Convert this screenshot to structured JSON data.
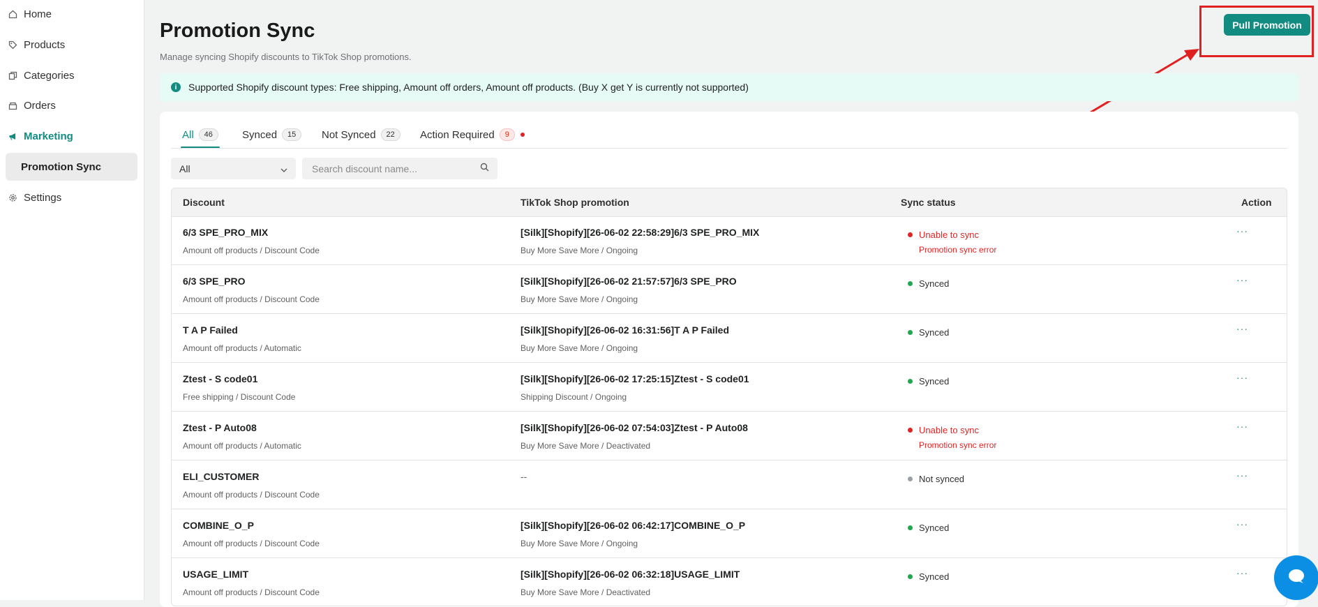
{
  "sidebar": {
    "items": [
      {
        "label": "Home",
        "icon": "home-icon"
      },
      {
        "label": "Products",
        "icon": "tag-icon"
      },
      {
        "label": "Categories",
        "icon": "categories-icon"
      },
      {
        "label": "Orders",
        "icon": "orders-icon"
      },
      {
        "label": "Marketing",
        "icon": "megaphone-icon"
      },
      {
        "label": "Promotion Sync"
      },
      {
        "label": "Settings",
        "icon": "gear-icon"
      }
    ]
  },
  "header": {
    "title": "Promotion Sync",
    "subtitle": "Manage syncing Shopify discounts to TikTok Shop promotions.",
    "pull_button": "Pull Promotion"
  },
  "banner": {
    "text": "Supported Shopify discount types: Free shipping, Amount off orders, Amount off products. (Buy X get Y is currently not supported)"
  },
  "tabs": [
    {
      "label": "All",
      "count": "46"
    },
    {
      "label": "Synced",
      "count": "15"
    },
    {
      "label": "Not Synced",
      "count": "22"
    },
    {
      "label": "Action Required",
      "count": "9"
    }
  ],
  "filter": {
    "selected": "All"
  },
  "search": {
    "placeholder": "Search discount name..."
  },
  "table": {
    "headers": [
      "Discount",
      "TikTok Shop promotion",
      "Sync status",
      "Action"
    ],
    "action_label": "···",
    "rows": [
      {
        "name": "6/3 SPE_PRO_MIX",
        "type": "Amount off products / Discount Code",
        "promo": "[Silk][Shopify][26-06-02 22:58:29]6/3 SPE_PRO_MIX",
        "promo_sub": "Buy More Save More / Ongoing",
        "status": "Unable to sync",
        "status_detail": "Promotion sync error"
      },
      {
        "name": "6/3 SPE_PRO",
        "type": "Amount off products / Discount Code",
        "promo": "[Silk][Shopify][26-06-02 21:57:57]6/3 SPE_PRO",
        "promo_sub": "Buy More Save More / Ongoing",
        "status": "Synced",
        "status_detail": ""
      },
      {
        "name": "T A P Failed",
        "type": "Amount off products / Automatic",
        "promo": "[Silk][Shopify][26-06-02 16:31:56]T A P Failed",
        "promo_sub": "Buy More Save More / Ongoing",
        "status": "Synced",
        "status_detail": ""
      },
      {
        "name": "Ztest - S code01",
        "type": "Free shipping / Discount Code",
        "promo": "[Silk][Shopify][26-06-02 17:25:15]Ztest - S code01",
        "promo_sub": "Shipping Discount / Ongoing",
        "status": "Synced",
        "status_detail": ""
      },
      {
        "name": "Ztest - P Auto08",
        "type": "Amount off products / Automatic",
        "promo": "[Silk][Shopify][26-06-02 07:54:03]Ztest - P Auto08",
        "promo_sub": "Buy More Save More / Deactivated",
        "status": "Unable to sync",
        "status_detail": "Promotion sync error"
      },
      {
        "name": "ELI_CUSTOMER",
        "type": "Amount off products / Discount Code",
        "promo": "--",
        "promo_sub": "",
        "status": "Not synced",
        "status_detail": ""
      },
      {
        "name": "COMBINE_O_P",
        "type": "Amount off products / Discount Code",
        "promo": "[Silk][Shopify][26-06-02 06:42:17]COMBINE_O_P",
        "promo_sub": "Buy More Save More / Ongoing",
        "status": "Synced",
        "status_detail": ""
      },
      {
        "name": "USAGE_LIMIT",
        "type": "Amount off products / Discount Code",
        "promo": "[Silk][Shopify][26-06-02 06:32:18]USAGE_LIMIT",
        "promo_sub": "Buy More Save More / Deactivated",
        "status": "Synced",
        "status_detail": ""
      }
    ]
  },
  "colors": {
    "accent": "#128c81",
    "error": "#e02424",
    "success": "#1fa84f",
    "neutral": "#9aa0a6",
    "annotation": "#e02020"
  }
}
